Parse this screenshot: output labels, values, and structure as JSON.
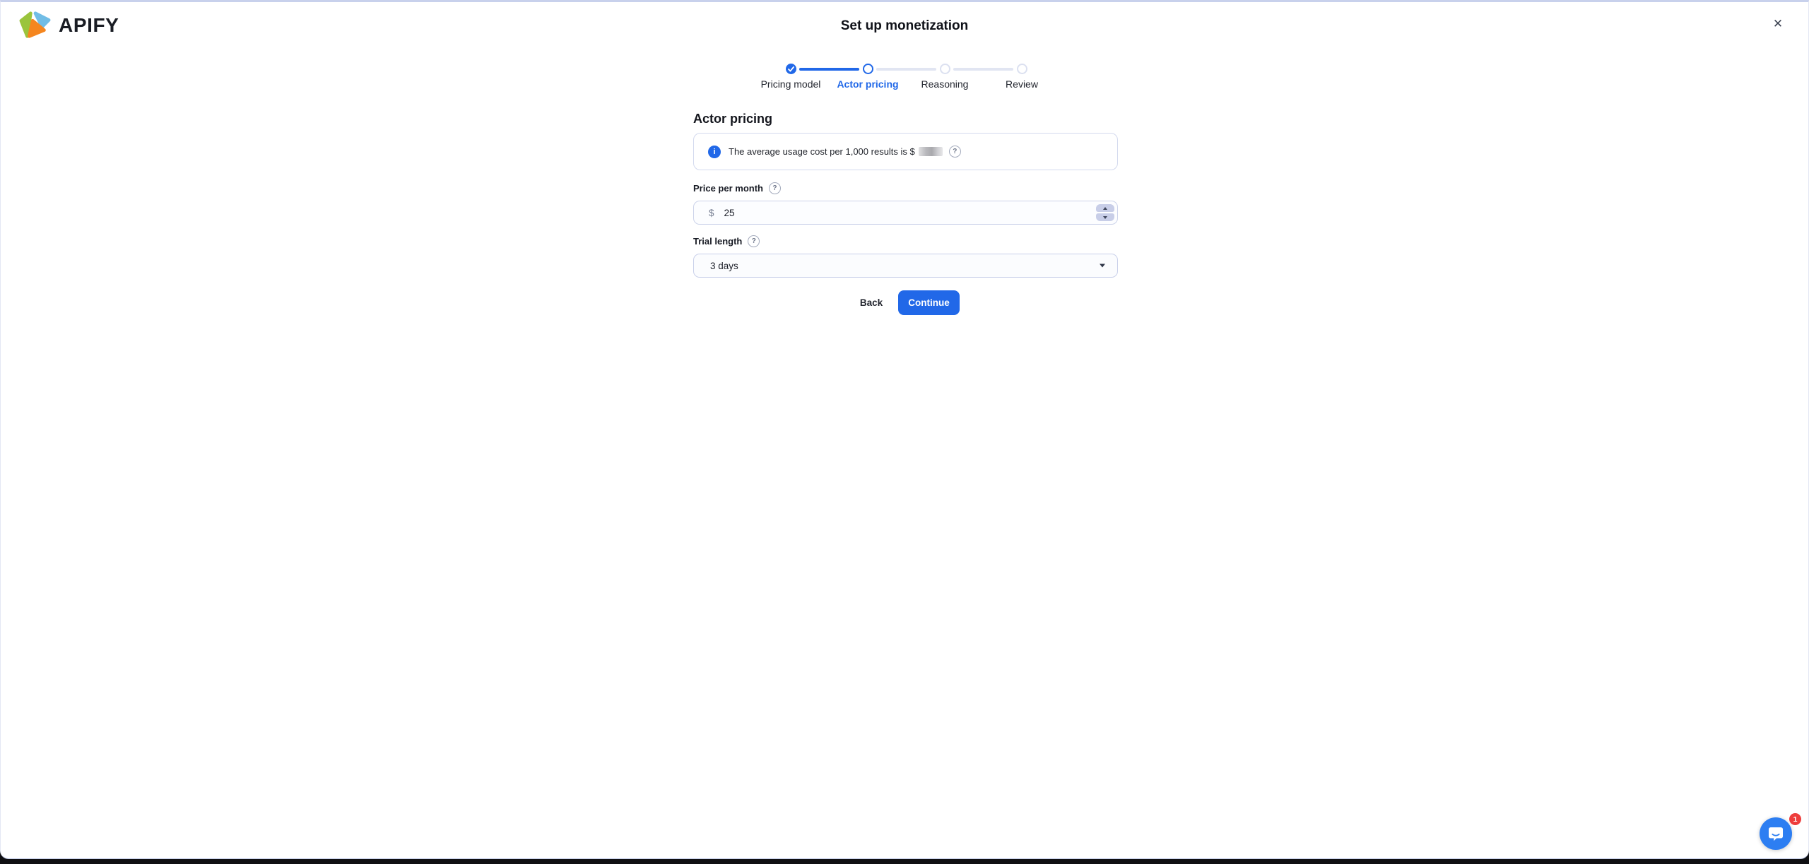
{
  "brand": {
    "name": "APIFY"
  },
  "modal": {
    "title": "Set up monetization"
  },
  "icons": {
    "close": "✕",
    "info": "i",
    "help": "?"
  },
  "stepper": {
    "steps": [
      {
        "label": "Pricing model",
        "state": "completed"
      },
      {
        "label": "Actor pricing",
        "state": "active"
      },
      {
        "label": "Reasoning",
        "state": "upcoming"
      },
      {
        "label": "Review",
        "state": "upcoming"
      }
    ]
  },
  "content": {
    "heading": "Actor pricing",
    "info_banner": {
      "text": "The average usage cost per 1,000 results is $",
      "value_redacted": true
    },
    "price_field": {
      "label": "Price per month",
      "currency_symbol": "$",
      "value": "25"
    },
    "trial_field": {
      "label": "Trial length",
      "selected_option": "3 days"
    },
    "actions": {
      "back_label": "Back",
      "continue_label": "Continue"
    }
  },
  "chat": {
    "unread_count": "1"
  },
  "colors": {
    "accent": "#2168e8",
    "badge_red": "#ee3d3c",
    "chat_blue": "#2d7ef2",
    "logo_green": "#9ac43c",
    "logo_blue": "#71bde6",
    "logo_orange": "#f5861f"
  }
}
